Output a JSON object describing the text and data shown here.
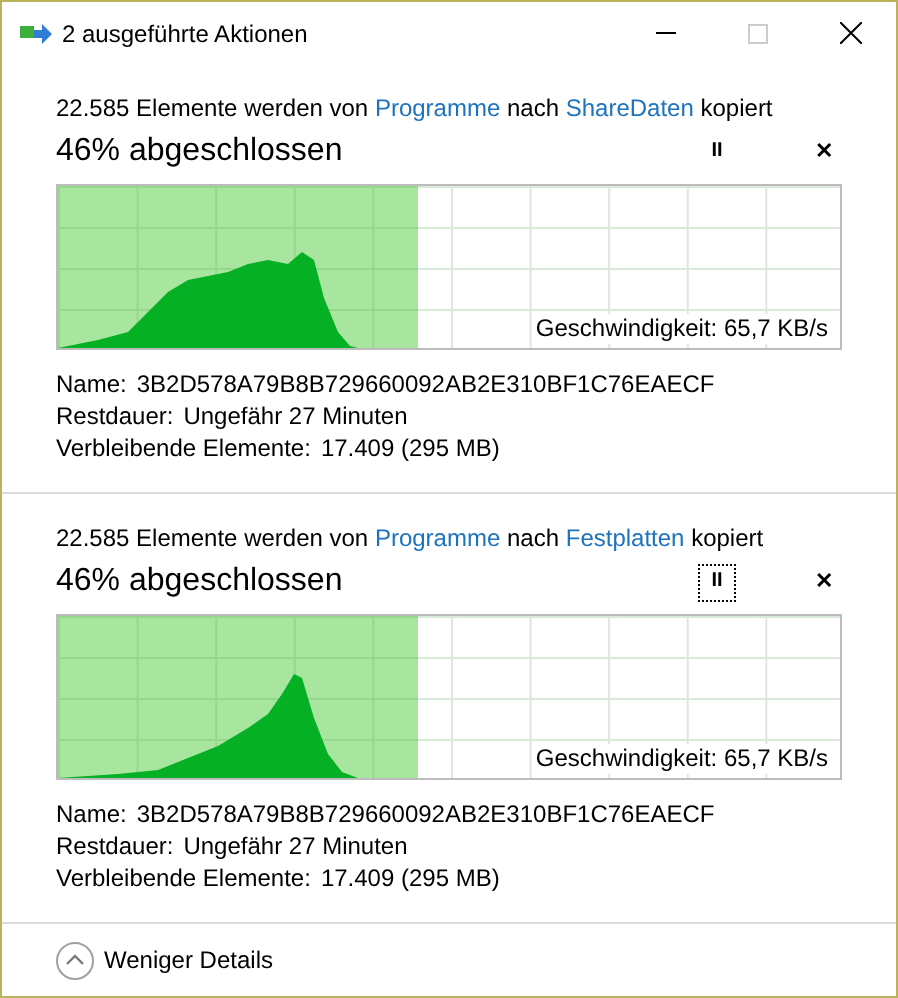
{
  "window": {
    "title": "2 ausgeführte Aktionen"
  },
  "operations": [
    {
      "prefix": "22.585 Elemente werden von",
      "source": "Programme",
      "connector": "nach",
      "destination": "ShareDaten",
      "suffix": "kopiert",
      "progress_text": "46% abgeschlossen",
      "level": 0.46,
      "pause_focused": false,
      "pause": "II",
      "cancel": "✕",
      "speed": "Geschwindigkeit: 65,7 KB/s",
      "details": [
        {
          "label": "Name:",
          "value": "3B2D578A79B8B729660092AB2E310BF1C76EAECF"
        },
        {
          "label": "Restdauer:",
          "value": "Ungefähr 27 Minuten"
        },
        {
          "label": "Verbleibende Elemente:",
          "value": "17.409 (295 MB)"
        }
      ]
    },
    {
      "prefix": "22.585 Elemente werden von",
      "source": "Programme",
      "connector": "nach",
      "destination": "Festplatten",
      "suffix": "kopiert",
      "progress_text": "46% abgeschlossen",
      "level": 0.46,
      "pause_focused": true,
      "pause": "II",
      "cancel": "✕",
      "speed": "Geschwindigkeit: 65,7 KB/s",
      "details": [
        {
          "label": "Name:",
          "value": "3B2D578A79B8B729660092AB2E310BF1C76EAECF"
        },
        {
          "label": "Restdauer:",
          "value": "Ungefähr 27 Minuten"
        },
        {
          "label": "Verbleibende Elemente:",
          "value": "17.409 (295 MB)"
        }
      ]
    }
  ],
  "footer": {
    "label": "Weniger Details"
  }
}
